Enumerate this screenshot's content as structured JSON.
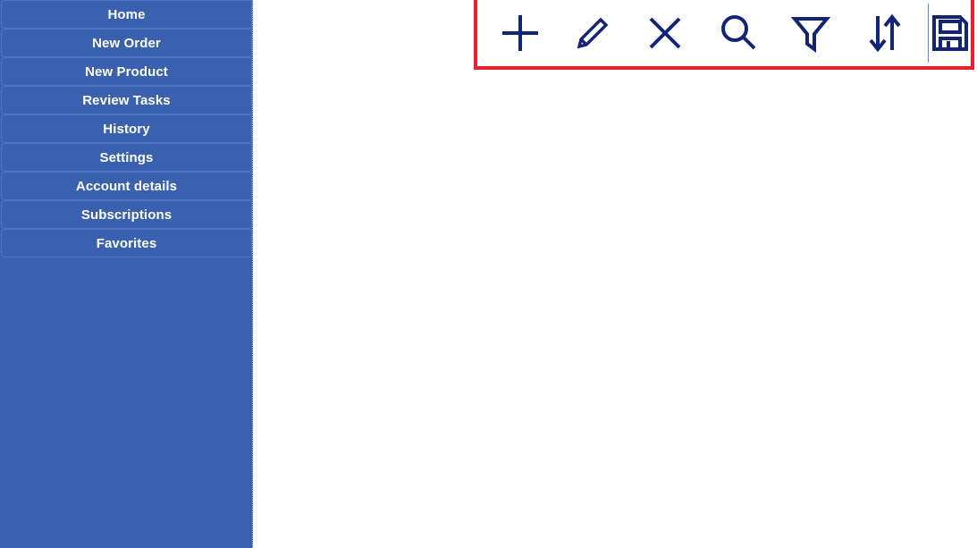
{
  "sidebar": {
    "background_color": "#3a61ad",
    "text_color": "#ffffff",
    "items": [
      {
        "label": "Home",
        "name": "home"
      },
      {
        "label": "New Order",
        "name": "new-order"
      },
      {
        "label": "New Product",
        "name": "new-product"
      },
      {
        "label": "Review Tasks",
        "name": "review-tasks"
      },
      {
        "label": "History",
        "name": "history"
      },
      {
        "label": "Settings",
        "name": "settings"
      },
      {
        "label": "Account details",
        "name": "account-details"
      },
      {
        "label": "Subscriptions",
        "name": "subscriptions"
      },
      {
        "label": "Favorites",
        "name": "favorites"
      }
    ]
  },
  "toolbar": {
    "highlight_color": "#ec1e32",
    "icon_color": "#122473",
    "buttons": [
      {
        "name": "add-icon",
        "label": "Add"
      },
      {
        "name": "edit-pencil-icon",
        "label": "Edit"
      },
      {
        "name": "close-icon",
        "label": "Delete"
      },
      {
        "name": "search-icon",
        "label": "Search"
      },
      {
        "name": "filter-icon",
        "label": "Filter"
      },
      {
        "name": "sort-icon",
        "label": "Sort"
      },
      {
        "name": "save-floppy-icon",
        "label": "Save"
      }
    ]
  },
  "content": {
    "body_text": ""
  }
}
